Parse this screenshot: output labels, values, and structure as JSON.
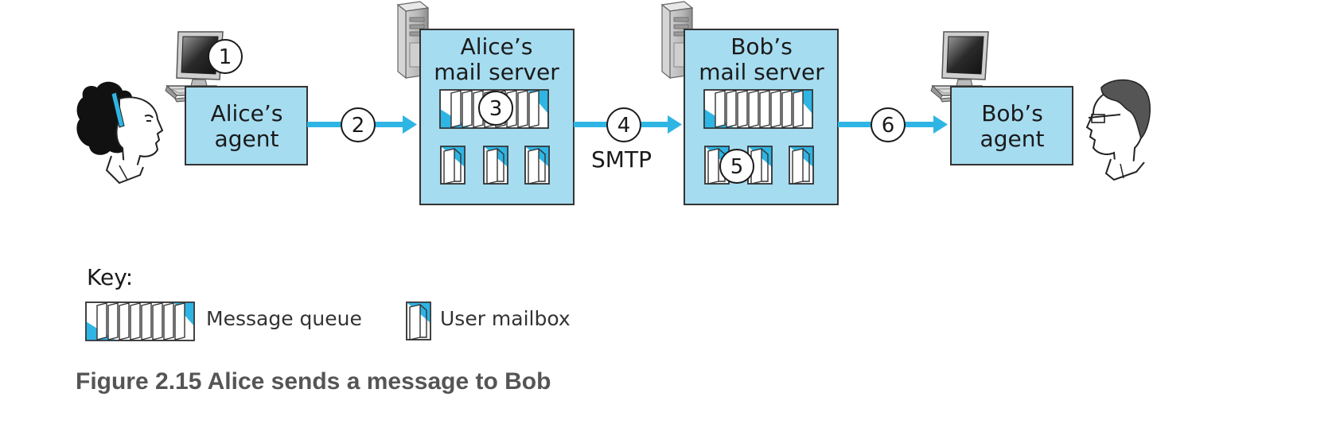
{
  "colors": {
    "box_fill": "#a6dcf0",
    "accent_blue": "#2fb5e4",
    "border": "#333333",
    "caption": "#555555"
  },
  "alice_agent": {
    "line1": "Alice’s",
    "line2": "agent"
  },
  "alice_server": {
    "line1": "Alice’s",
    "line2": "mail server"
  },
  "bob_server": {
    "line1": "Bob’s",
    "line2": "mail server"
  },
  "bob_agent": {
    "line1": "Bob’s",
    "line2": "agent"
  },
  "steps": [
    "1",
    "2",
    "3",
    "4",
    "5",
    "6"
  ],
  "protocol_label": "SMTP",
  "key": {
    "title": "Key:",
    "message_queue_label": "Message queue",
    "user_mailbox_label": "User mailbox"
  },
  "caption": "Figure 2.15 Alice sends a message to Bob",
  "icons": [
    "alice-person-icon",
    "bob-person-icon",
    "desktop-computer-icon",
    "server-tower-icon",
    "message-queue-icon",
    "user-mailbox-icon",
    "arrow-icon"
  ]
}
